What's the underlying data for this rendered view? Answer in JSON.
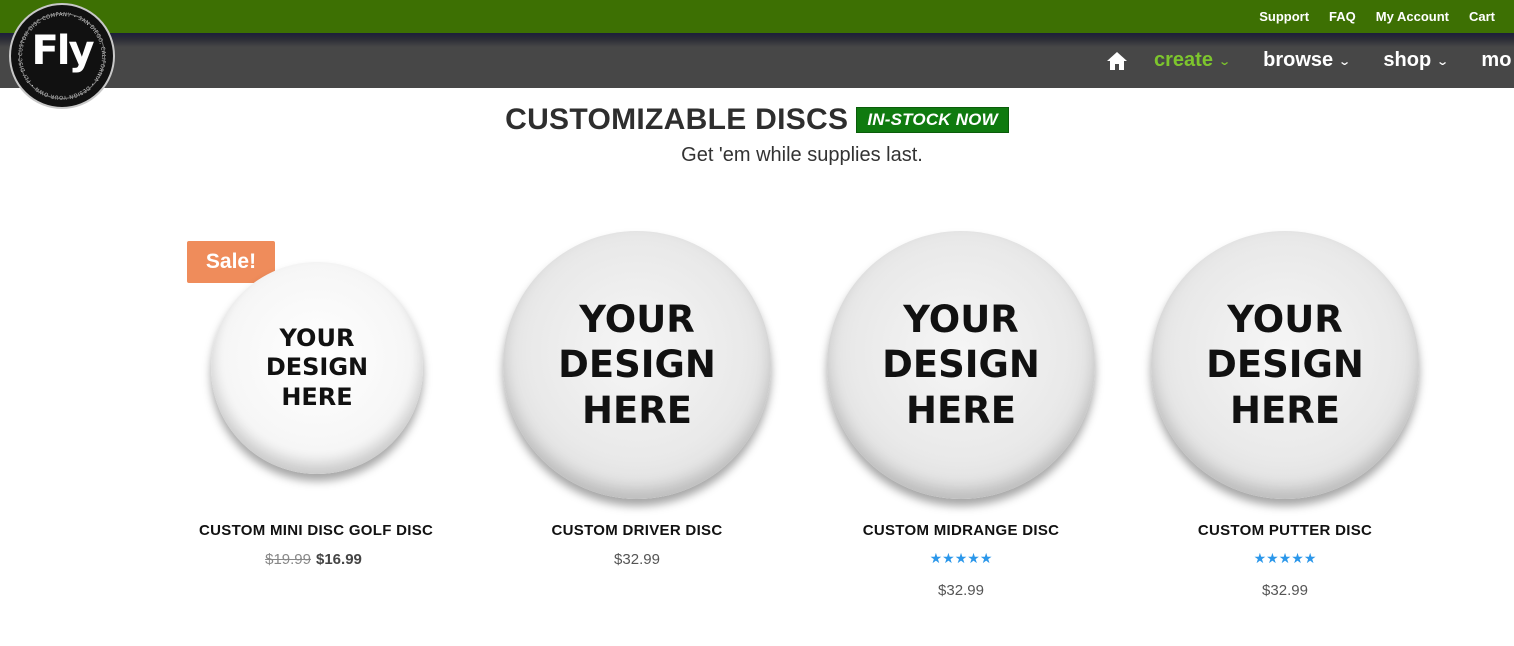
{
  "topbar": {
    "links": [
      "Support",
      "FAQ",
      "My Account",
      "Cart"
    ]
  },
  "nav": {
    "home_icon": "home-icon",
    "items": [
      {
        "label": "create",
        "active": true
      },
      {
        "label": "browse"
      },
      {
        "label": "shop"
      },
      {
        "label": "mo"
      }
    ]
  },
  "logo": {
    "mark": "Fly",
    "ring_text": "CUSTOM DISC COMPANY • SAN DIEGO, CALIFORNIA • DESIGN YOUR OWN • FLY DISCS •"
  },
  "heading": {
    "title": "CUSTOMIZABLE DISCS",
    "badge": "IN-STOCK NOW",
    "subtitle": "Get 'em while supplies last."
  },
  "products": [
    {
      "sale_badge": "Sale!",
      "art_lines": [
        "YOUR",
        "DESIGN",
        "HERE"
      ],
      "title": "CUSTOM MINI DISC GOLF DISC",
      "price_old": "$19.99",
      "price": "$16.99"
    },
    {
      "art_lines": [
        "YOUR",
        "DESIGN",
        "HERE"
      ],
      "title": "CUSTOM DRIVER DISC",
      "price": "$32.99"
    },
    {
      "art_lines": [
        "YOUR",
        "DESIGN",
        "HERE"
      ],
      "title": "CUSTOM MIDRANGE DISC",
      "rating_stars": "★★★★★",
      "price": "$32.99"
    },
    {
      "art_lines": [
        "YOUR",
        "DESIGN",
        "HERE"
      ],
      "title": "CUSTOM PUTTER DISC",
      "rating_stars": "★★★★★",
      "price": "$32.99"
    }
  ],
  "colors": {
    "topbar": "#3d7003",
    "navbar": "#474747",
    "nav_active": "#7dc52d",
    "badge": "#0f7a0f",
    "sale": "#ef8c5b",
    "stars": "#2b97ea"
  }
}
